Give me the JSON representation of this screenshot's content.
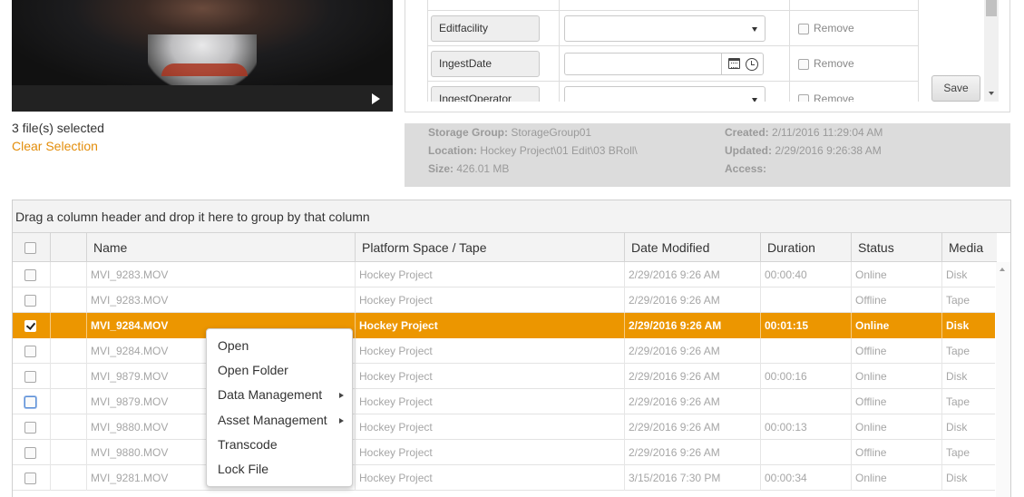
{
  "preview": {
    "files_selected": "3 file(s) selected",
    "clear_selection": "Clear Selection"
  },
  "metadata_form": {
    "fields": [
      {
        "label": "Editfacility",
        "kind": "select",
        "value": "",
        "remove_label": "Remove"
      },
      {
        "label": "IngestDate",
        "kind": "date",
        "value": "",
        "remove_label": "Remove"
      },
      {
        "label": "IngestOperator",
        "kind": "select",
        "value": "",
        "remove_label": "Remove"
      }
    ],
    "save_label": "Save"
  },
  "file_info": {
    "storage_group_label": "Storage Group:",
    "storage_group": "StorageGroup01",
    "location_label": "Location:",
    "location": "Hockey Project\\01 Edit\\03 BRoll\\",
    "size_label": "Size:",
    "size": "426.01 MB",
    "created_label": "Created:",
    "created": "2/11/2016 11:29:04 AM",
    "updated_label": "Updated:",
    "updated": "2/29/2016 9:26:38 AM",
    "access_label": "Access:",
    "access": ""
  },
  "grid": {
    "group_hint": "Drag a column header and drop it here to group by that column",
    "columns": [
      "Name",
      "Platform Space / Tape",
      "Date Modified",
      "Duration",
      "Status",
      "Media"
    ],
    "rows": [
      {
        "name": "MVI_9283.MOV",
        "platform": "Hockey Project",
        "date": "2/29/2016 9:26 AM",
        "duration": "00:00:40",
        "status": "Online",
        "media": "Disk",
        "selected": false
      },
      {
        "name": "MVI_9283.MOV",
        "platform": "Hockey Project",
        "date": "2/29/2016 9:26 AM",
        "duration": "",
        "status": "Offline",
        "media": "Tape",
        "selected": false
      },
      {
        "name": "MVI_9284.MOV",
        "platform": "Hockey Project",
        "date": "2/29/2016 9:26 AM",
        "duration": "00:01:15",
        "status": "Online",
        "media": "Disk",
        "selected": true
      },
      {
        "name": "MVI_9284.MOV",
        "platform": "Hockey Project",
        "date": "2/29/2016 9:26 AM",
        "duration": "",
        "status": "Offline",
        "media": "Tape",
        "selected": false
      },
      {
        "name": "MVI_9879.MOV",
        "platform": "Hockey Project",
        "date": "2/29/2016 9:26 AM",
        "duration": "00:00:16",
        "status": "Online",
        "media": "Disk",
        "selected": false
      },
      {
        "name": "MVI_9879.MOV",
        "platform": "Hockey Project",
        "date": "2/29/2016 9:26 AM",
        "duration": "",
        "status": "Offline",
        "media": "Tape",
        "selected": false
      },
      {
        "name": "MVI_9880.MOV",
        "platform": "Hockey Project",
        "date": "2/29/2016 9:26 AM",
        "duration": "00:00:13",
        "status": "Online",
        "media": "Disk",
        "selected": false
      },
      {
        "name": "MVI_9880.MOV",
        "platform": "Hockey Project",
        "date": "2/29/2016 9:26 AM",
        "duration": "",
        "status": "Offline",
        "media": "Tape",
        "selected": false
      },
      {
        "name": "MVI_9281.MOV",
        "platform": "Hockey Project",
        "date": "3/15/2016 7:30 PM",
        "duration": "00:00:34",
        "status": "Online",
        "media": "Disk",
        "selected": false
      }
    ]
  },
  "context_menu": {
    "items": [
      {
        "label": "Open",
        "submenu": false
      },
      {
        "label": "Open Folder",
        "submenu": false
      },
      {
        "label": "Data Management",
        "submenu": true
      },
      {
        "label": "Asset Management",
        "submenu": true
      },
      {
        "label": "Transcode",
        "submenu": false
      },
      {
        "label": "Lock File",
        "submenu": false
      }
    ]
  },
  "colors": {
    "accent": "#ec9600",
    "link": "#e38d0a"
  }
}
